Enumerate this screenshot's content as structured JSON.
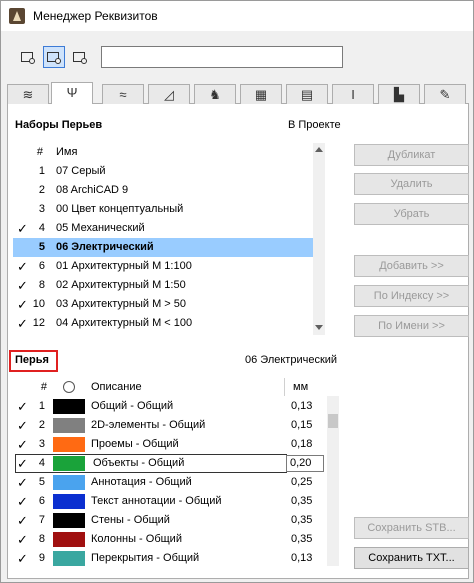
{
  "window": {
    "title": "Менеджер Реквизитов"
  },
  "tabs": [
    "layers-icon",
    "pen-icon",
    "line-type-icon",
    "fill-icon",
    "brush-icon",
    "composite-icon",
    "profile-icon",
    "column-icon",
    "zone-icon",
    "surface-icon"
  ],
  "pensets": {
    "header": "Наборы Перьев",
    "in_project": "В Проекте",
    "col_num": "#",
    "col_name": "Имя",
    "rows": [
      {
        "check": "",
        "num": "1",
        "name": "07 Серый"
      },
      {
        "check": "",
        "num": "2",
        "name": "08 ArchiCAD 9"
      },
      {
        "check": "",
        "num": "3",
        "name": "00 Цвет концептуальный"
      },
      {
        "check": "✓",
        "num": "4",
        "name": "05 Механический"
      },
      {
        "check": "",
        "num": "5",
        "name": "06 Электрический"
      },
      {
        "check": "✓",
        "num": "6",
        "name": "01 Архитектурный М 1:100"
      },
      {
        "check": "✓",
        "num": "8",
        "name": "02 Архитектурный М 1:50"
      },
      {
        "check": "✓",
        "num": "10",
        "name": "03 Архитектурный М > 50"
      },
      {
        "check": "✓",
        "num": "12",
        "name": "04 Архитектурный М < 100"
      }
    ]
  },
  "buttons": {
    "duplicate": "Дубликат",
    "delete": "Удалить",
    "remove": "Убрать",
    "add": "Добавить >>",
    "by_index": "По Индексу >>",
    "by_name": "По Имени >>",
    "save_stb": "Сохранить STB...",
    "save_txt": "Сохранить TXT..."
  },
  "pens": {
    "header": "Перья",
    "current_set": "06 Электрический",
    "col_num": "#",
    "col_desc": "Описание",
    "col_mm": "мм",
    "rows": [
      {
        "check": "✓",
        "num": "1",
        "color": "#000000",
        "desc": "Общий - Общий",
        "mm": "0,13"
      },
      {
        "check": "✓",
        "num": "2",
        "color": "#808080",
        "desc": "2D-элементы - Общий",
        "mm": "0,15"
      },
      {
        "check": "✓",
        "num": "3",
        "color": "#ff6a13",
        "desc": "Проемы - Общий",
        "mm": "0,18"
      },
      {
        "check": "✓",
        "num": "4",
        "color": "#1aa33a",
        "desc": "Объекты - Общий",
        "mm": "0,20"
      },
      {
        "check": "✓",
        "num": "5",
        "color": "#4aa3ee",
        "desc": "Аннотация - Общий",
        "mm": "0,25"
      },
      {
        "check": "✓",
        "num": "6",
        "color": "#0b2fd0",
        "desc": "Текст аннотации - Общий",
        "mm": "0,35"
      },
      {
        "check": "✓",
        "num": "7",
        "color": "#000000",
        "desc": "Стены - Общий",
        "mm": "0,35"
      },
      {
        "check": "✓",
        "num": "8",
        "color": "#a01010",
        "desc": "Колонны - Общий",
        "mm": "0,35"
      },
      {
        "check": "✓",
        "num": "9",
        "color": "#3aa7a0",
        "desc": "Перекрытия - Общий",
        "mm": "0,13"
      }
    ]
  }
}
